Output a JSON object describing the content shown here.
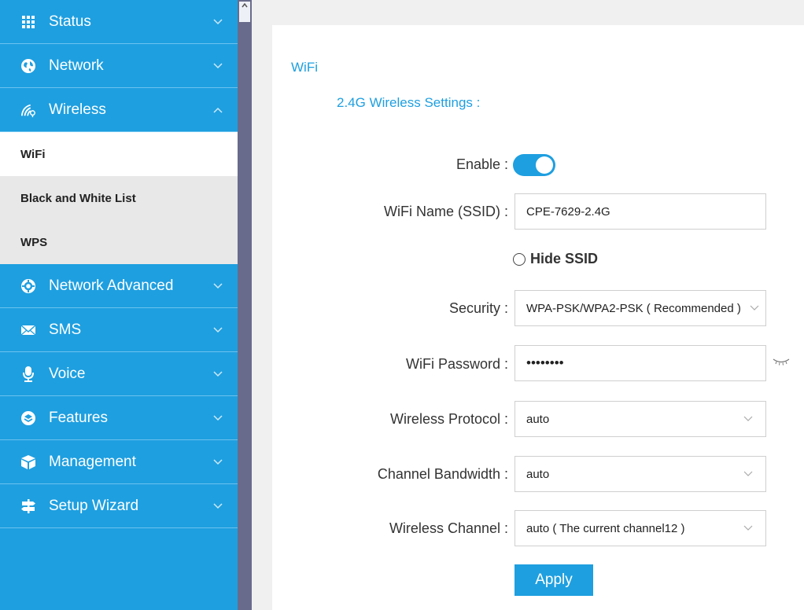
{
  "sidebar": {
    "menu": [
      {
        "label": "Status",
        "icon": "grid-icon",
        "expanded": false
      },
      {
        "label": "Network",
        "icon": "globe-icon",
        "expanded": false
      },
      {
        "label": "Wireless",
        "icon": "wireless-icon",
        "expanded": true
      }
    ],
    "submenu": [
      {
        "label": "WiFi",
        "active": true
      },
      {
        "label": "Black and White List",
        "active": false
      },
      {
        "label": "WPS",
        "active": false
      }
    ],
    "menu2": [
      {
        "label": "Network Advanced",
        "icon": "gear-icon"
      },
      {
        "label": "SMS",
        "icon": "envelope-icon"
      },
      {
        "label": "Voice",
        "icon": "microphone-icon"
      },
      {
        "label": "Features",
        "icon": "layers-icon"
      },
      {
        "label": "Management",
        "icon": "cube-icon"
      },
      {
        "label": "Setup Wizard",
        "icon": "signpost-icon"
      }
    ]
  },
  "main": {
    "page_title": "WiFi",
    "section_title": "2.4G Wireless Settings :",
    "enable_label": "Enable :",
    "enable_on": true,
    "ssid_label": "WiFi Name (SSID) :",
    "ssid_value": "CPE-7629-2.4G",
    "hide_ssid_label": "Hide SSID",
    "security_label": "Security :",
    "security_value": "WPA-PSK/WPA2-PSK ( Recommended )",
    "password_label": "WiFi Password :",
    "password_value": "••••••••",
    "protocol_label": "Wireless Protocol :",
    "protocol_value": "auto",
    "bandwidth_label": "Channel Bandwidth :",
    "bandwidth_value": "auto",
    "channel_label": "Wireless Channel :",
    "channel_value": "auto ( The current channel12 )",
    "apply_label": "Apply"
  },
  "colors": {
    "accent": "#1e9fe0",
    "submenu_bg": "#e8e8e8",
    "scroll_col": "#696b8c"
  }
}
